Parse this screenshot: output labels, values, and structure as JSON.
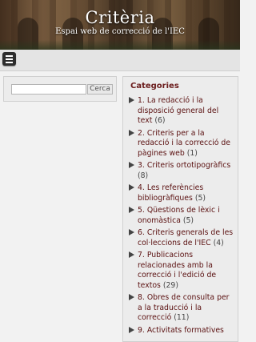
{
  "header": {
    "title": "Critèria",
    "tagline": "Espai web de correcció de l'IEC"
  },
  "navbar": {
    "menu_icon": "hamburger-menu-icon"
  },
  "search": {
    "placeholder": "",
    "button_label": "Cerca"
  },
  "categories": {
    "heading": "Categories",
    "items": [
      {
        "label": "1. La redacció i la disposició general del text",
        "count": "(6)"
      },
      {
        "label": "2. Criteris per a la redacció i la correcció de pàgines web",
        "count": "(1)"
      },
      {
        "label": "3. Criteris ortotipogràfics",
        "count": "(8)"
      },
      {
        "label": "4. Les referències bibliogràfiques",
        "count": "(5)"
      },
      {
        "label": "5. Qüestions de lèxic i onomàstica",
        "count": "(5)"
      },
      {
        "label": "6. Criteris generals de les col·leccions de l'IEC",
        "count": "(4)"
      },
      {
        "label": "7. Publicacions relacionades amb la correcció i l'edició de textos",
        "count": "(29)"
      },
      {
        "label": "8. Obres de consulta per a la traducció i la correcció",
        "count": "(11)"
      },
      {
        "label": "9. Activitats formatives",
        "count": ""
      }
    ]
  }
}
